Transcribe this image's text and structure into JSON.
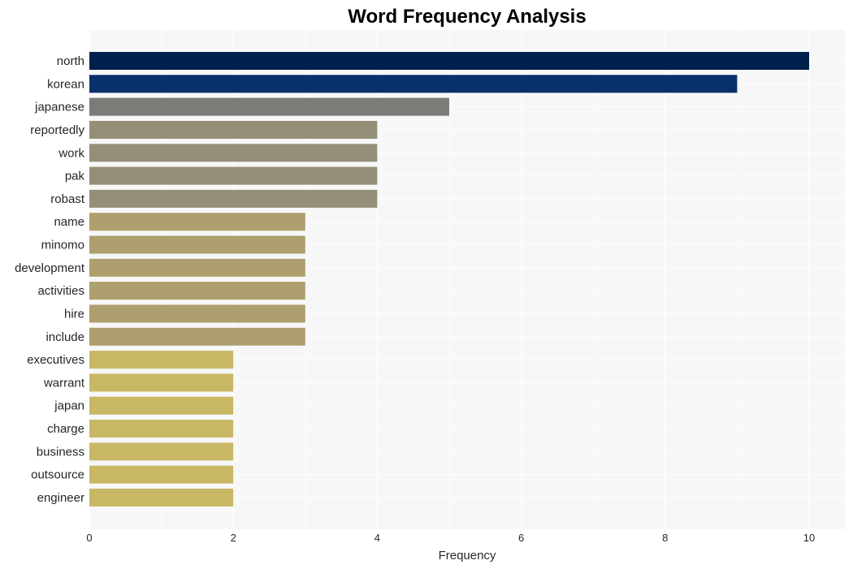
{
  "chart_data": {
    "type": "bar",
    "orientation": "horizontal",
    "title": "Word Frequency Analysis",
    "xlabel": "Frequency",
    "ylabel": "",
    "xlim": [
      0,
      10.5
    ],
    "xticks": [
      0,
      2,
      4,
      6,
      8,
      10
    ],
    "grid": true,
    "categories": [
      "north",
      "korean",
      "japanese",
      "reportedly",
      "work",
      "pak",
      "robast",
      "name",
      "minomo",
      "development",
      "activities",
      "hire",
      "include",
      "executives",
      "warrant",
      "japan",
      "charge",
      "business",
      "outsource",
      "engineer"
    ],
    "values": [
      10,
      9,
      5,
      4,
      4,
      4,
      4,
      3,
      3,
      3,
      3,
      3,
      3,
      2,
      2,
      2,
      2,
      2,
      2,
      2
    ],
    "colors": [
      "#00204d",
      "#08306b",
      "#7c7b78",
      "#958f78",
      "#958f78",
      "#958f78",
      "#958f78",
      "#ae9f6f",
      "#ae9f6f",
      "#ae9f6f",
      "#ae9f6f",
      "#ae9f6f",
      "#ae9f6f",
      "#c8b866",
      "#c8b866",
      "#c8b866",
      "#c8b866",
      "#c8b866",
      "#c8b866",
      "#c8b866"
    ]
  }
}
